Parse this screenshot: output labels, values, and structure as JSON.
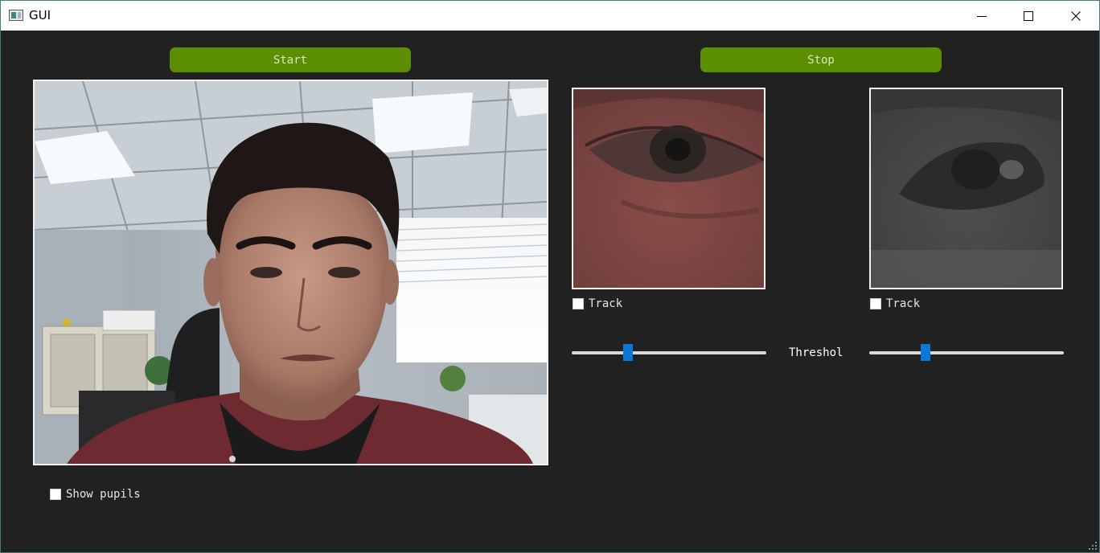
{
  "window": {
    "title": "GUI",
    "icons": {
      "app": "app-icon",
      "minimize": "minimize-icon",
      "maximize": "maximize-icon",
      "close": "close-icon"
    }
  },
  "controls": {
    "start_label": "Start",
    "stop_label": "Stop"
  },
  "views": {
    "camera": "webcam-frame",
    "left_eye": "left-eye-crop",
    "right_eye": "right-eye-threshold"
  },
  "left_eye": {
    "track_label": "Track",
    "track_checked": false,
    "threshold_value": 0.29
  },
  "right_eye": {
    "track_label": "Track",
    "track_checked": false,
    "threshold_value": 0.29
  },
  "threshold_label": "Threshol",
  "show_pupils": {
    "label": "Show pupils",
    "checked": false
  },
  "colors": {
    "background": "#212121",
    "button": "#5b8e00",
    "slider_handle": "#0a78d7"
  }
}
